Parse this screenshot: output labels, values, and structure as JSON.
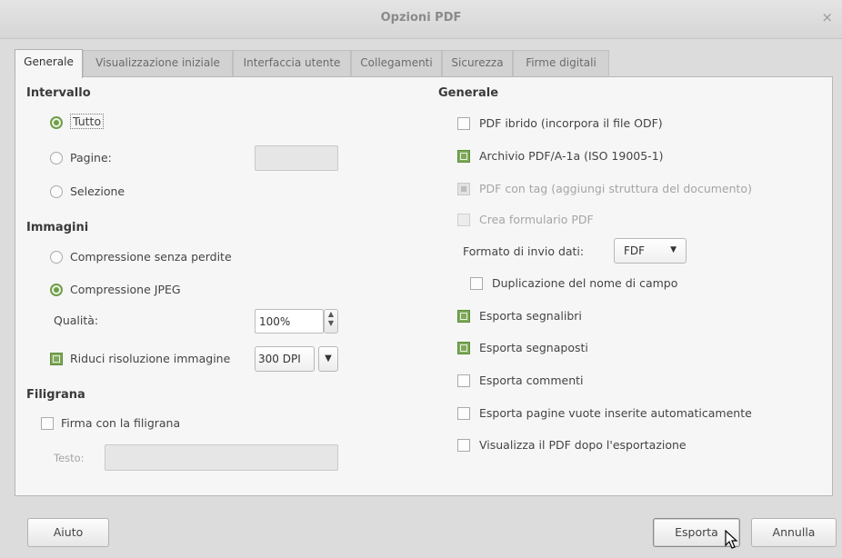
{
  "window": {
    "title": "Opzioni PDF",
    "close_symbol": "×"
  },
  "tabs": [
    {
      "label": "Generale",
      "active": true
    },
    {
      "label": "Visualizzazione iniziale",
      "active": false
    },
    {
      "label": "Interfaccia utente",
      "active": false
    },
    {
      "label": "Collegamenti",
      "active": false
    },
    {
      "label": "Sicurezza",
      "active": false
    },
    {
      "label": "Firme digitali",
      "active": false
    }
  ],
  "intervallo": {
    "heading": "Intervallo",
    "tutto": "Tutto",
    "pagine": "Pagine:",
    "pagine_value": "",
    "selezione": "Selezione",
    "selected": "Tutto"
  },
  "immagini": {
    "heading": "Immagini",
    "lossless": "Compressione senza perdite",
    "jpeg": "Compressione JPEG",
    "selected": "Compressione JPEG",
    "quality_label": "Qualità:",
    "quality_value": "100%",
    "reduce_label": "Riduci risoluzione immagine",
    "reduce_checked": true,
    "dpi_value": "300 DPI"
  },
  "filigrana": {
    "heading": "Filigrana",
    "sign_label": "Firma con la filigrana",
    "sign_checked": false,
    "text_label": "Testo:",
    "text_value": ""
  },
  "generale": {
    "heading": "Generale",
    "options": {
      "hybrid": {
        "label": "PDF ibrido (incorpora il file ODF)",
        "checked": false
      },
      "archive": {
        "label": "Archivio PDF/A-1a (ISO 19005-1)",
        "checked": true
      },
      "tagged": {
        "label": "PDF con tag (aggiungi struttura del documento)",
        "checked": true,
        "disabled": true
      },
      "form": {
        "label": "Crea formulario PDF",
        "checked": false,
        "disabled": true
      },
      "duplicate": {
        "label": "Duplicazione del nome di campo",
        "checked": false
      },
      "bookmarks": {
        "label": "Esporta segnalibri",
        "checked": true
      },
      "placeholders": {
        "label": "Esporta segnaposti",
        "checked": true
      },
      "comments": {
        "label": "Esporta commenti",
        "checked": false
      },
      "blank_pages": {
        "label": "Esporta pagine vuote inserite automaticamente",
        "checked": false
      },
      "view_after": {
        "label": "Visualizza il PDF dopo l'esportazione",
        "checked": false
      }
    },
    "submit_format_label": "Formato di invio dati:",
    "submit_format_value": "FDF"
  },
  "footer": {
    "help": "Aiuto",
    "export": "Esporta",
    "cancel": "Annulla"
  },
  "colors": {
    "accent_green": "#6f9e4a",
    "panel_bg": "#f6f6f6",
    "window_bg": "#dcdcdc"
  },
  "icons": {
    "dropdown": "▼",
    "spin_up": "▲",
    "spin_down": "▼"
  }
}
